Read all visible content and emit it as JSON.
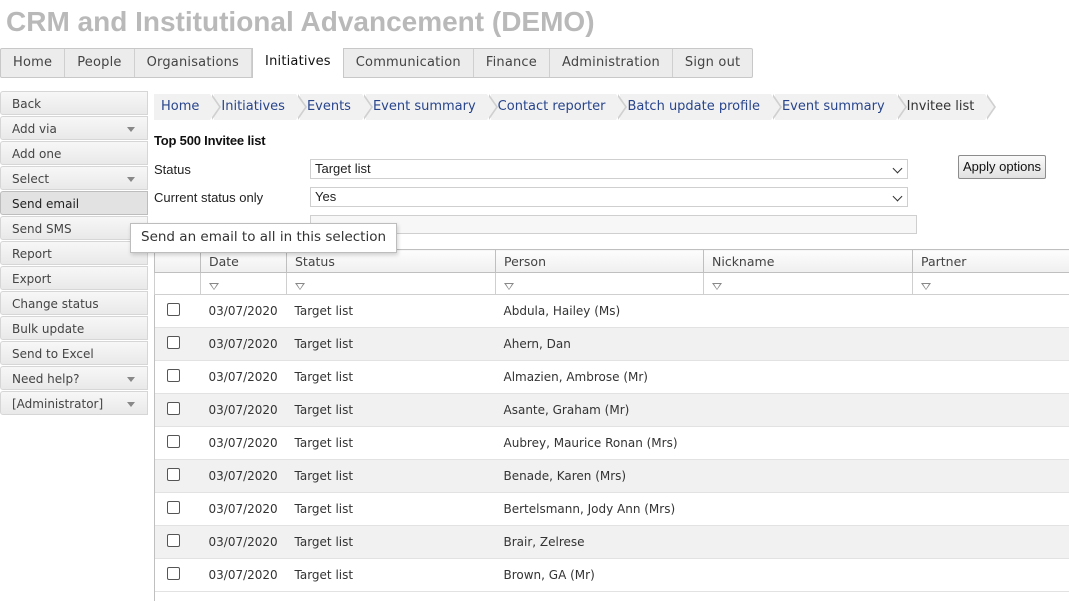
{
  "app": {
    "title": "CRM and Institutional Advancement (DEMO)"
  },
  "topnav": {
    "tabs": [
      {
        "label": "Home",
        "active": false
      },
      {
        "label": "People",
        "active": false
      },
      {
        "label": "Organisations",
        "active": false
      },
      {
        "label": "Initiatives",
        "active": true
      },
      {
        "label": "Communication",
        "active": false
      },
      {
        "label": "Finance",
        "active": false
      },
      {
        "label": "Administration",
        "active": false
      },
      {
        "label": "Sign out",
        "active": false
      }
    ]
  },
  "sidebar": {
    "items": [
      {
        "label": "Back",
        "dropdown": false
      },
      {
        "label": "Add via",
        "dropdown": true
      },
      {
        "label": "Add one",
        "dropdown": false
      },
      {
        "label": "Select",
        "dropdown": true
      },
      {
        "label": "Send email",
        "dropdown": false,
        "active": true
      },
      {
        "label": "Send SMS",
        "dropdown": false
      },
      {
        "label": "Report",
        "dropdown": false
      },
      {
        "label": "Export",
        "dropdown": false
      },
      {
        "label": "Change status",
        "dropdown": false
      },
      {
        "label": "Bulk update",
        "dropdown": false
      },
      {
        "label": "Send to Excel",
        "dropdown": false
      },
      {
        "label": "Need help?",
        "dropdown": true
      },
      {
        "label": "[Administrator]",
        "dropdown": true
      }
    ]
  },
  "tooltip": {
    "text": "Send an email to all in this selection"
  },
  "breadcrumb": [
    "Home",
    "Initiatives",
    "Events",
    "Event summary",
    "Contact reporter",
    "Batch update profile",
    "Event summary",
    "Invitee list"
  ],
  "list": {
    "title": "Top 500 Invitee list"
  },
  "filters": {
    "status_label": "Status",
    "status_value": "Target list",
    "current_label": "Current status only",
    "current_value": "Yes",
    "apply_label": "Apply options"
  },
  "grid": {
    "columns": [
      "Date",
      "Status",
      "Person",
      "Nickname",
      "Partner"
    ],
    "rows": [
      [
        "03/07/2020",
        "Target list",
        "Abdula, Hailey (Ms)",
        "",
        ""
      ],
      [
        "03/07/2020",
        "Target list",
        "Ahern, Dan",
        "",
        ""
      ],
      [
        "03/07/2020",
        "Target list",
        "Almazien, Ambrose (Mr)",
        "",
        ""
      ],
      [
        "03/07/2020",
        "Target list",
        "Asante, Graham (Mr)",
        "",
        ""
      ],
      [
        "03/07/2020",
        "Target list",
        "Aubrey, Maurice Ronan (Mrs)",
        "",
        ""
      ],
      [
        "03/07/2020",
        "Target list",
        "Benade, Karen (Mrs)",
        "",
        ""
      ],
      [
        "03/07/2020",
        "Target list",
        "Bertelsmann, Jody Ann (Mrs)",
        "",
        ""
      ],
      [
        "03/07/2020",
        "Target list",
        "Brair, Zelrese",
        "",
        ""
      ],
      [
        "03/07/2020",
        "Target list",
        "Brown, GA (Mr)",
        "",
        ""
      ]
    ]
  }
}
